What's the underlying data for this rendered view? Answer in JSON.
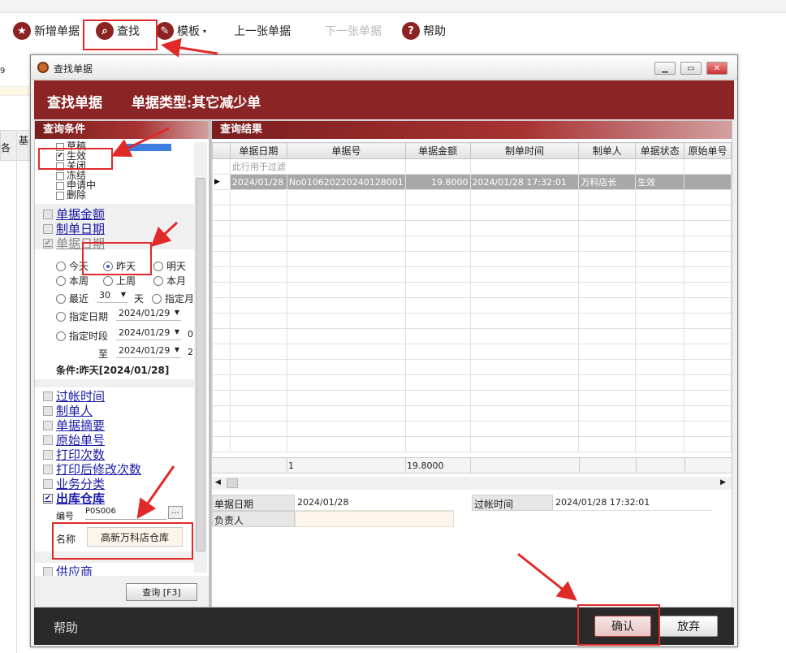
{
  "app_toolbar": {
    "new_doc": "新增单据",
    "find": "查找",
    "template": "模板",
    "prev_doc": "上一张单据",
    "next_doc": "下一张单据",
    "help": "帮助"
  },
  "bg_fragments": {
    "a": "9",
    "b": "各",
    "c": "基",
    "d": "基"
  },
  "dialog": {
    "title": "查找单据",
    "header_title": "查找单据",
    "header_type": "单据类型:其它减少单",
    "query_conditions": "查询条件",
    "query_results": "查询结果",
    "status_items": [
      {
        "label": "草稿",
        "checked": false
      },
      {
        "label": "生效",
        "checked": true
      },
      {
        "label": "关闭",
        "checked": false
      },
      {
        "label": "冻结",
        "checked": false
      },
      {
        "label": "申请中",
        "checked": false
      },
      {
        "label": "删除",
        "checked": false
      }
    ],
    "fields_top": [
      {
        "label": "单据金额",
        "checked": false
      },
      {
        "label": "制单日期",
        "checked": false
      },
      {
        "label": "单据日期",
        "checked": true
      }
    ],
    "date_radios": {
      "today": "今天",
      "yesterday": "昨天",
      "tomorrow": "明天",
      "this_week": "本周",
      "last_week": "上周",
      "this_month": "本月",
      "recent": "最近",
      "recent_days": "30",
      "days": "天",
      "specified_month": "指定月",
      "specified_date": "指定日期",
      "specified_date_val": "2024/01/29",
      "specified_range": "指定时段",
      "range_from": "2024/01/29",
      "range_from_extra": "0",
      "to": "至",
      "range_to": "2024/01/29",
      "range_to_extra": "2"
    },
    "condition_text": "条件:昨天[2024/01/28]",
    "fields_bottom": [
      {
        "label": "过帐时间",
        "checked": false
      },
      {
        "label": "制单人",
        "checked": false
      },
      {
        "label": "单据摘要",
        "checked": false
      },
      {
        "label": "原始单号",
        "checked": false
      },
      {
        "label": "打印次数",
        "checked": false
      },
      {
        "label": "打印后修改次数",
        "checked": false
      },
      {
        "label": "业务分类",
        "checked": false
      },
      {
        "label": "出库仓库",
        "checked": true
      }
    ],
    "warehouse": {
      "code_label": "编号",
      "code_value": "P0S006",
      "browse": "...",
      "name_label": "名称",
      "name_value": "高新万科店仓库"
    },
    "supplier": "供应商",
    "query_button": "查询 [F3]",
    "grid": {
      "columns": [
        "单据日期",
        "单据号",
        "单据金额",
        "制单时间",
        "制单人",
        "单据状态",
        "原始单号"
      ],
      "filter_hint": "此行用于过滤",
      "rows": [
        [
          "2024/01/28",
          "No010620220240128001",
          "19.8000",
          "2024/01/28 17:32:01",
          "万科店长",
          "生效",
          ""
        ]
      ],
      "footer_count": "1",
      "footer_amount": "19.8000"
    },
    "detail": {
      "doc_date_label": "单据日期",
      "doc_date": "2024/01/28",
      "post_time_label": "过帐时间",
      "post_time": "2024/01/28 17:32:01",
      "owner_label": "负责人",
      "owner": ""
    },
    "help": "帮助",
    "confirm": "确认",
    "discard": "放弃"
  }
}
